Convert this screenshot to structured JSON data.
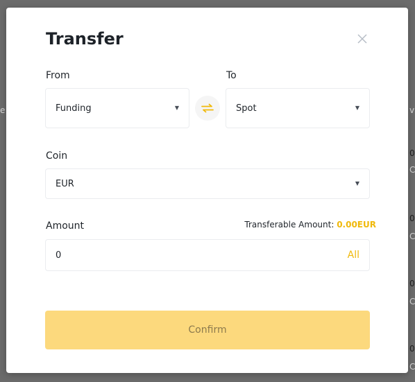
{
  "dialog": {
    "title": "Transfer",
    "from_label": "From",
    "to_label": "To",
    "from_value": "Funding",
    "to_value": "Spot",
    "coin_label": "Coin",
    "coin_value": "EUR",
    "amount_label": "Amount",
    "transferable_label": "Transferable Amount:",
    "transferable_amount": "0.00EUR",
    "amount_value": "0",
    "all_label": "All",
    "confirm_label": "Confirm"
  },
  "background": {
    "fragments": [
      "e",
      "v",
      "0",
      "C",
      "0",
      "C",
      "0",
      "C",
      "0",
      "C"
    ]
  },
  "icons": {
    "close": "close-icon",
    "swap": "swap-arrows-icon",
    "caret": "caret-down-icon"
  },
  "colors": {
    "accent": "#f0b90b",
    "confirm_bg": "#fcd97d",
    "overlay": "#6b6b6b"
  }
}
